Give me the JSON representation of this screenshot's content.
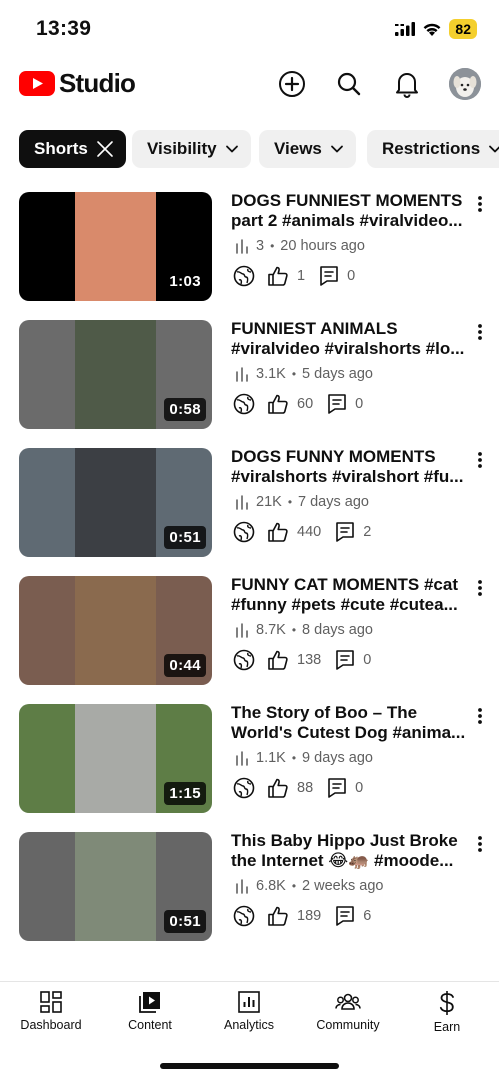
{
  "status_bar": {
    "time": "13:39",
    "battery": "82"
  },
  "header": {
    "app_name": "Studio",
    "brand_color": "#ff0000"
  },
  "chips": [
    {
      "label": "Shorts",
      "active": true
    },
    {
      "label": "Visibility"
    },
    {
      "label": "Views"
    },
    {
      "label": "Restrictions"
    }
  ],
  "videos": [
    {
      "title_line1": "DOGS FUNNIEST MOMENTS",
      "title_line2": "part 2 #animals #viralvideo...",
      "views": "3",
      "age": "20 hours ago",
      "likes": "1",
      "comments": "0",
      "duration": "1:03",
      "thumb_side_color": "#000000",
      "thumb_mid_color": "#d98a6b"
    },
    {
      "title_line1": "FUNNIEST ANIMALS",
      "title_line2": "#viralvideo #viralshorts #lo...",
      "views": "3.1K",
      "age": "5 days ago",
      "likes": "60",
      "comments": "0",
      "duration": "0:58",
      "thumb_side_color": "#6b6b6b",
      "thumb_mid_color": "#4f5a48"
    },
    {
      "title_line1": "DOGS FUNNY MOMENTS",
      "title_line2": "#viralshorts #viralshort #fu...",
      "views": "21K",
      "age": "7 days ago",
      "likes": "440",
      "comments": "2",
      "duration": "0:51",
      "thumb_side_color": "#5f6a73",
      "thumb_mid_color": "#3c3f44"
    },
    {
      "title_line1": "FUNNY CAT MOMENTS #cat",
      "title_line2": "#funny #pets #cute #cutea...",
      "views": "8.7K",
      "age": "8 days ago",
      "likes": "138",
      "comments": "0",
      "duration": "0:44",
      "thumb_side_color": "#7a5d50",
      "thumb_mid_color": "#8a6a4e"
    },
    {
      "title_line1": "The Story of Boo – The",
      "title_line2": "World's Cutest Dog #anima...",
      "views": "1.1K",
      "age": "9 days ago",
      "likes": "88",
      "comments": "0",
      "duration": "1:15",
      "thumb_side_color": "#5e7d46",
      "thumb_mid_color": "#a8aaa6"
    },
    {
      "title_line1": "This Baby Hippo Just Broke",
      "title_line2": "the Internet 😂🦛 #moode...",
      "views": "6.8K",
      "age": "2 weeks ago",
      "likes": "189",
      "comments": "6",
      "duration": "0:51",
      "thumb_side_color": "#666666",
      "thumb_mid_color": "#7f8a78"
    }
  ],
  "bottom_nav": [
    {
      "label": "Dashboard",
      "icon": "dashboard-icon"
    },
    {
      "label": "Content",
      "icon": "content-icon"
    },
    {
      "label": "Analytics",
      "icon": "analytics-icon"
    },
    {
      "label": "Community",
      "icon": "community-icon"
    },
    {
      "label": "Earn",
      "icon": "earn-icon"
    }
  ]
}
